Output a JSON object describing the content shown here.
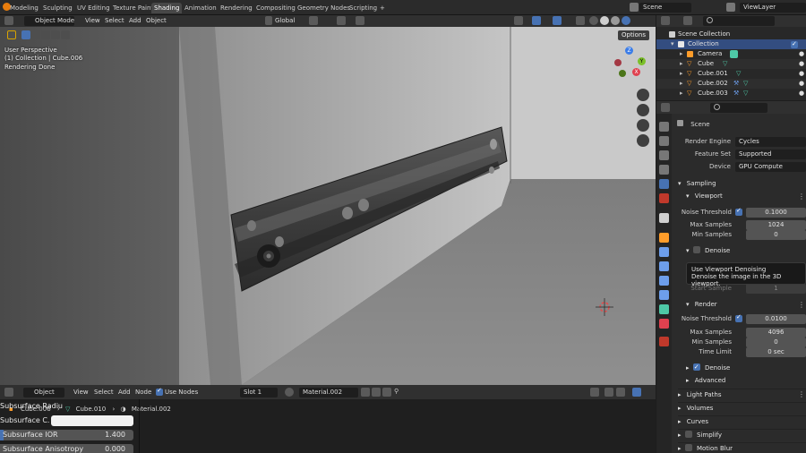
{
  "workspace_tabs": [
    "Modeling",
    "Sculpting",
    "UV Editing",
    "Texture Paint",
    "Shading",
    "Animation",
    "Rendering",
    "Compositing",
    "Geometry Nodes",
    "Scripting"
  ],
  "active_tab": "Shading",
  "add_tab_label": "+",
  "scene_selector": "Scene",
  "viewlayer_selector": "ViewLayer",
  "viewport": {
    "mode": "Object Mode",
    "menu": [
      "View",
      "Select",
      "Add",
      "Object"
    ],
    "transform_orientation": "Global",
    "options_label": "Options",
    "overlay": {
      "line1": "User Perspective",
      "line2": "(1) Collection | Cube.006",
      "line3": "Rendering Done"
    },
    "gizmo": {
      "z": "Z",
      "y": "Y",
      "x": "X"
    }
  },
  "outliner": {
    "root": "Scene Collection",
    "items": [
      {
        "label": "Collection",
        "type": "collection"
      },
      {
        "label": "Camera",
        "type": "camera"
      },
      {
        "label": "Cube",
        "type": "mesh"
      },
      {
        "label": "Cube.001",
        "type": "mesh"
      },
      {
        "label": "Cube.002",
        "type": "mesh"
      },
      {
        "label": "Cube.003",
        "type": "mesh"
      }
    ]
  },
  "properties": {
    "context": "Scene",
    "render_engine_label": "Render Engine",
    "render_engine": "Cycles",
    "feature_set_label": "Feature Set",
    "feature_set": "Supported",
    "device_label": "Device",
    "device": "GPU Compute",
    "sampling_label": "Sampling",
    "viewport_label": "Viewport",
    "noise_threshold_label": "Noise Threshold",
    "viewport_noise_threshold": "0.1000",
    "max_samples_label": "Max Samples",
    "viewport_max_samples": "1024",
    "min_samples_label": "Min Samples",
    "viewport_min_samples": "0",
    "denoise_label": "Denoise",
    "start_sample_label": "Start Sample",
    "start_sample": "1",
    "render_label": "Render",
    "render_noise_threshold": "0.0100",
    "render_max_samples": "4096",
    "render_min_samples": "0",
    "time_limit_label": "Time Limit",
    "time_limit": "0 sec",
    "advanced_label": "Advanced",
    "light_paths_label": "Light Paths",
    "volumes_label": "Volumes",
    "curves_label": "Curves",
    "simplify_label": "Simplify",
    "motion_blur_label": "Motion Blur",
    "tooltip_title": "Use Viewport Denoising",
    "tooltip_desc": "Denoise the image in the 3D viewport."
  },
  "node_editor": {
    "object_mode": "Object",
    "menu": [
      "View",
      "Select",
      "Add",
      "Node"
    ],
    "use_nodes_label": "Use Nodes",
    "slot": "Slot 1",
    "material": "Material.002",
    "breadcrumb": [
      "Cube.006",
      "Cube.010",
      "Material.002"
    ],
    "fields": {
      "subsurface_radius": "Subsurface Radius",
      "subsurface_color": "Subsurface C...",
      "subsurface_ior_label": "Subsurface IOR",
      "subsurface_ior": "1.400",
      "subsurface_aniso_label": "Subsurface Anisotropy",
      "subsurface_aniso": "0.000"
    }
  },
  "colors": {
    "accent": "#4772b3",
    "selection": "#334d80",
    "mesh_icon": "#ff9d2a",
    "data_icon": "#4ec9a6",
    "x_axis": "#e0414f",
    "y_axis": "#7cc02a",
    "z_axis": "#3b7de8"
  }
}
